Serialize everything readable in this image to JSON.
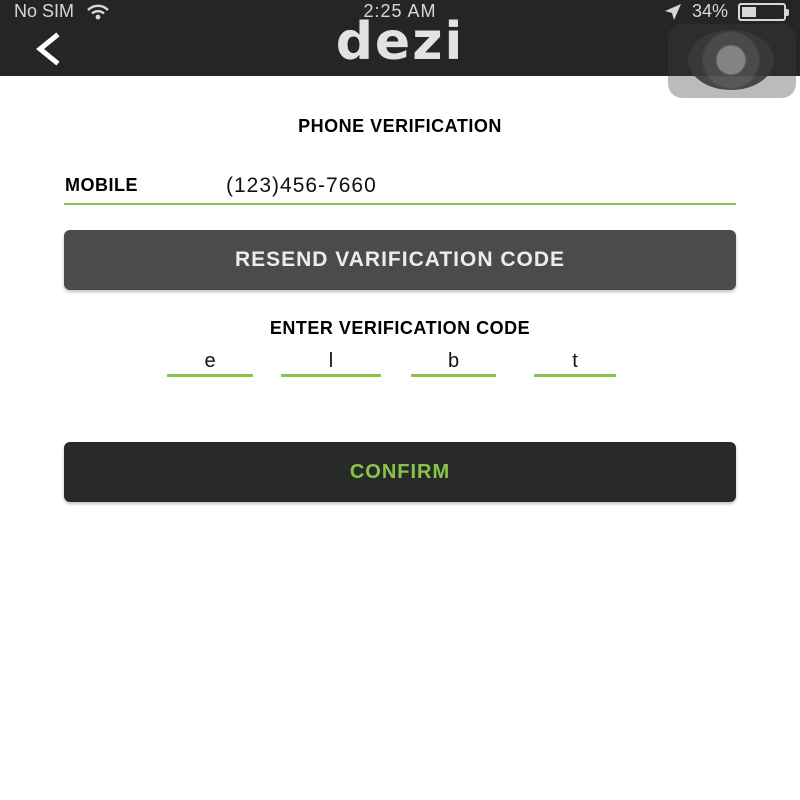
{
  "status_bar": {
    "carrier": "No SIM",
    "time": "2:25 AM",
    "battery": "34%",
    "battery_level": 0.34,
    "icons": [
      "wifi-icon",
      "location-arrow-icon",
      "battery-icon"
    ]
  },
  "nav": {
    "back_icon": "chevron-left-icon",
    "logo": "dezi"
  },
  "page": {
    "title": "PHONE VERIFICATION",
    "mobile_label": "MOBILE",
    "mobile_value": "(123)456-7660",
    "resend_label": "RESEND VARIFICATION CODE",
    "enter_code_label": "ENTER VERIFICATION CODE",
    "code_digits": [
      "e",
      "l",
      "b",
      "t"
    ],
    "confirm_label": "CONFIRM"
  },
  "colors": {
    "header_bg": "#242624",
    "accent": "#8bc34a",
    "resend_bg": "#4a4c4b",
    "confirm_bg": "#282a29"
  }
}
